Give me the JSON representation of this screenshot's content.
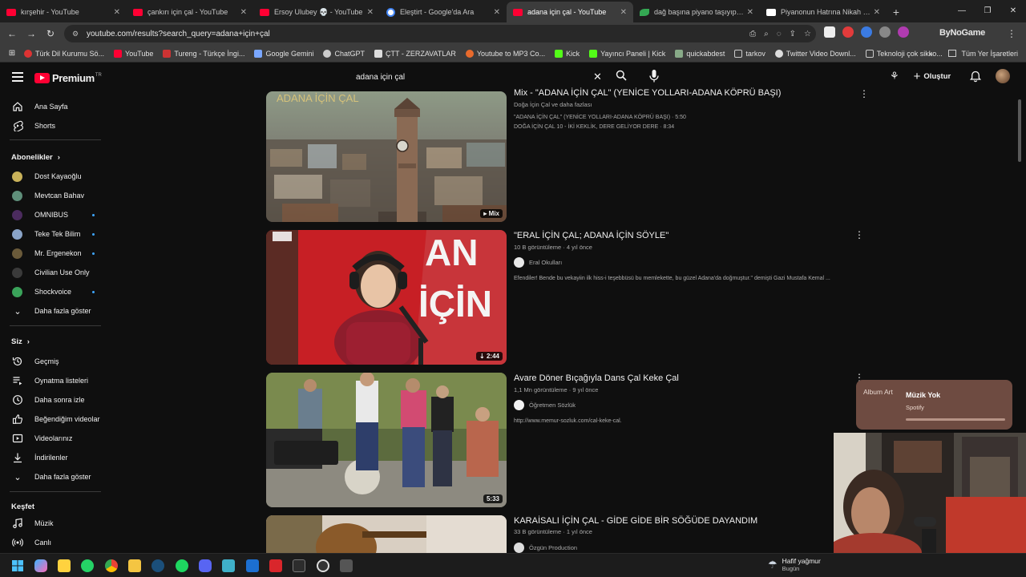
{
  "browser": {
    "tabs": [
      {
        "title": "kırşehir - YouTube",
        "favicon": "youtube-icon"
      },
      {
        "title": "çankırı için çal - YouTube",
        "favicon": "youtube-icon"
      },
      {
        "title": "Ersoy Ulubey 💀 - YouTube",
        "favicon": "youtube-icon"
      },
      {
        "title": "Eleştirt - Google'da Ara",
        "favicon": "google-icon"
      },
      {
        "title": "adana için çal - YouTube",
        "favicon": "youtube-icon",
        "active": true
      },
      {
        "title": "dağ başına piyano taşıyıp klip ç",
        "favicon": "leaf-icon"
      },
      {
        "title": "Piyanonun Hatrına Nikah Masa",
        "favicon": "page-icon"
      }
    ],
    "url": "youtube.com/results?search_query=adana+için+çal",
    "extension_label": "ByNoGame",
    "bookmarks": [
      "Türk Dil Kurumu Sö...",
      "YouTube",
      "Tureng - Türkçe İngi...",
      "Google Gemini",
      "ChatGPT",
      "ÇTT - ZERZAVATLAR",
      "Youtube to MP3 Co...",
      "Kick",
      "Yayıncı Paneli | Kick",
      "quickabdest",
      "tarkov",
      "Twitter Video Downl...",
      "Teknoloji çok sikko..."
    ],
    "bookmarks_more": "»",
    "all_bookmarks": "Tüm Yer İşaretleri"
  },
  "youtube": {
    "logo_text": "Premium",
    "logo_region": "TR",
    "search_query": "adana için çal",
    "create_label": "Oluştur"
  },
  "sidebar": {
    "main": [
      {
        "label": "Ana Sayfa",
        "icon": "home-icon"
      },
      {
        "label": "Shorts",
        "icon": "shorts-icon"
      }
    ],
    "subs_header": "Abonelikler",
    "subs": [
      {
        "label": "Dost Kayaoğlu",
        "color": "#c9b25a",
        "dot": false
      },
      {
        "label": "Mevtcan Bahav",
        "color": "#5f8f7a",
        "dot": false
      },
      {
        "label": "OMNIBUS",
        "color": "#4b2b5e",
        "dot": true
      },
      {
        "label": "Teke Tek Bilim",
        "color": "#8aa4c8",
        "dot": true
      },
      {
        "label": "Mr. Ergenekon",
        "color": "#6a5a3a",
        "dot": true
      },
      {
        "label": "Civilian Use Only",
        "color": "#3a3a3a",
        "dot": false
      },
      {
        "label": "Shockvoice",
        "color": "#3aa35a",
        "dot": true
      }
    ],
    "subs_more": "Daha fazla göster",
    "you_header": "Siz",
    "you": [
      {
        "label": "Geçmiş",
        "icon": "history-icon"
      },
      {
        "label": "Oynatma listeleri",
        "icon": "playlist-icon"
      },
      {
        "label": "Daha sonra izle",
        "icon": "clock-icon"
      },
      {
        "label": "Beğendiğim videolar",
        "icon": "thumbs-up-icon"
      },
      {
        "label": "Videolarınız",
        "icon": "video-icon"
      },
      {
        "label": "İndirilenler",
        "icon": "download-icon"
      }
    ],
    "you_more": "Daha fazla göster",
    "explore_header": "Keşfet",
    "explore": [
      {
        "label": "Müzik",
        "icon": "music-icon"
      },
      {
        "label": "Canlı",
        "icon": "live-icon"
      }
    ]
  },
  "results": [
    {
      "title": "Mix - \"ADANA İÇİN ÇAL\" (YENİCE YOLLARI-ADANA KÖPRÜ BAŞI)",
      "meta": "Doğa İçin Çal ve daha fazlası",
      "desc1": "\"ADANA İÇİN ÇAL\" (YENİCE YOLLARI-ADANA KÖPRÜ BAŞI) · 5:50",
      "desc2": "DOĞA İÇİN ÇAL 10 - İKİ KEKLİK, DERE GELİYOR DERE · 8:34",
      "badge": "Mix",
      "thumb_text": "ADANA İÇİN ÇAL"
    },
    {
      "title": "\"ERAL İÇİN ÇAL; ADANA İÇİN SÖYLE\"",
      "meta": "10 B görüntüleme · 4 yıl önce",
      "channel": "Eral Okulları",
      "desc": "Efendiler! Bende bu vekayiin ilk hiss-i teşebbüsü bu memlekette, bu güzel Adana'da doğmuştur.\" demişti Gazi Mustafa Kemal ...",
      "duration": "2:44",
      "thumb_text": "AN İÇİN"
    },
    {
      "title": "Avare Döner Bıçağıyla Dans Çal Keke Çal",
      "meta": "1,1 Mn görüntüleme · 9 yıl önce",
      "channel": "Öğretmen Sözlük",
      "desc": "http://www.memur-sozluk.com/cal-keke-cal.",
      "duration": "5:33"
    },
    {
      "title": "KARAİSALI İÇİN ÇAL - GİDE GİDE BİR SÖĞÜDE DAYANDIM",
      "meta": "33 B görüntüleme · 1 yıl önce",
      "channel": "Özgün Production"
    }
  ],
  "miniplayer": {
    "art_alt": "Album Art",
    "title": "Müzik Yok",
    "subtitle": "Spotify"
  },
  "taskbar": {
    "weather_title": "Hafif yağmur",
    "weather_sub": "Bugün"
  }
}
